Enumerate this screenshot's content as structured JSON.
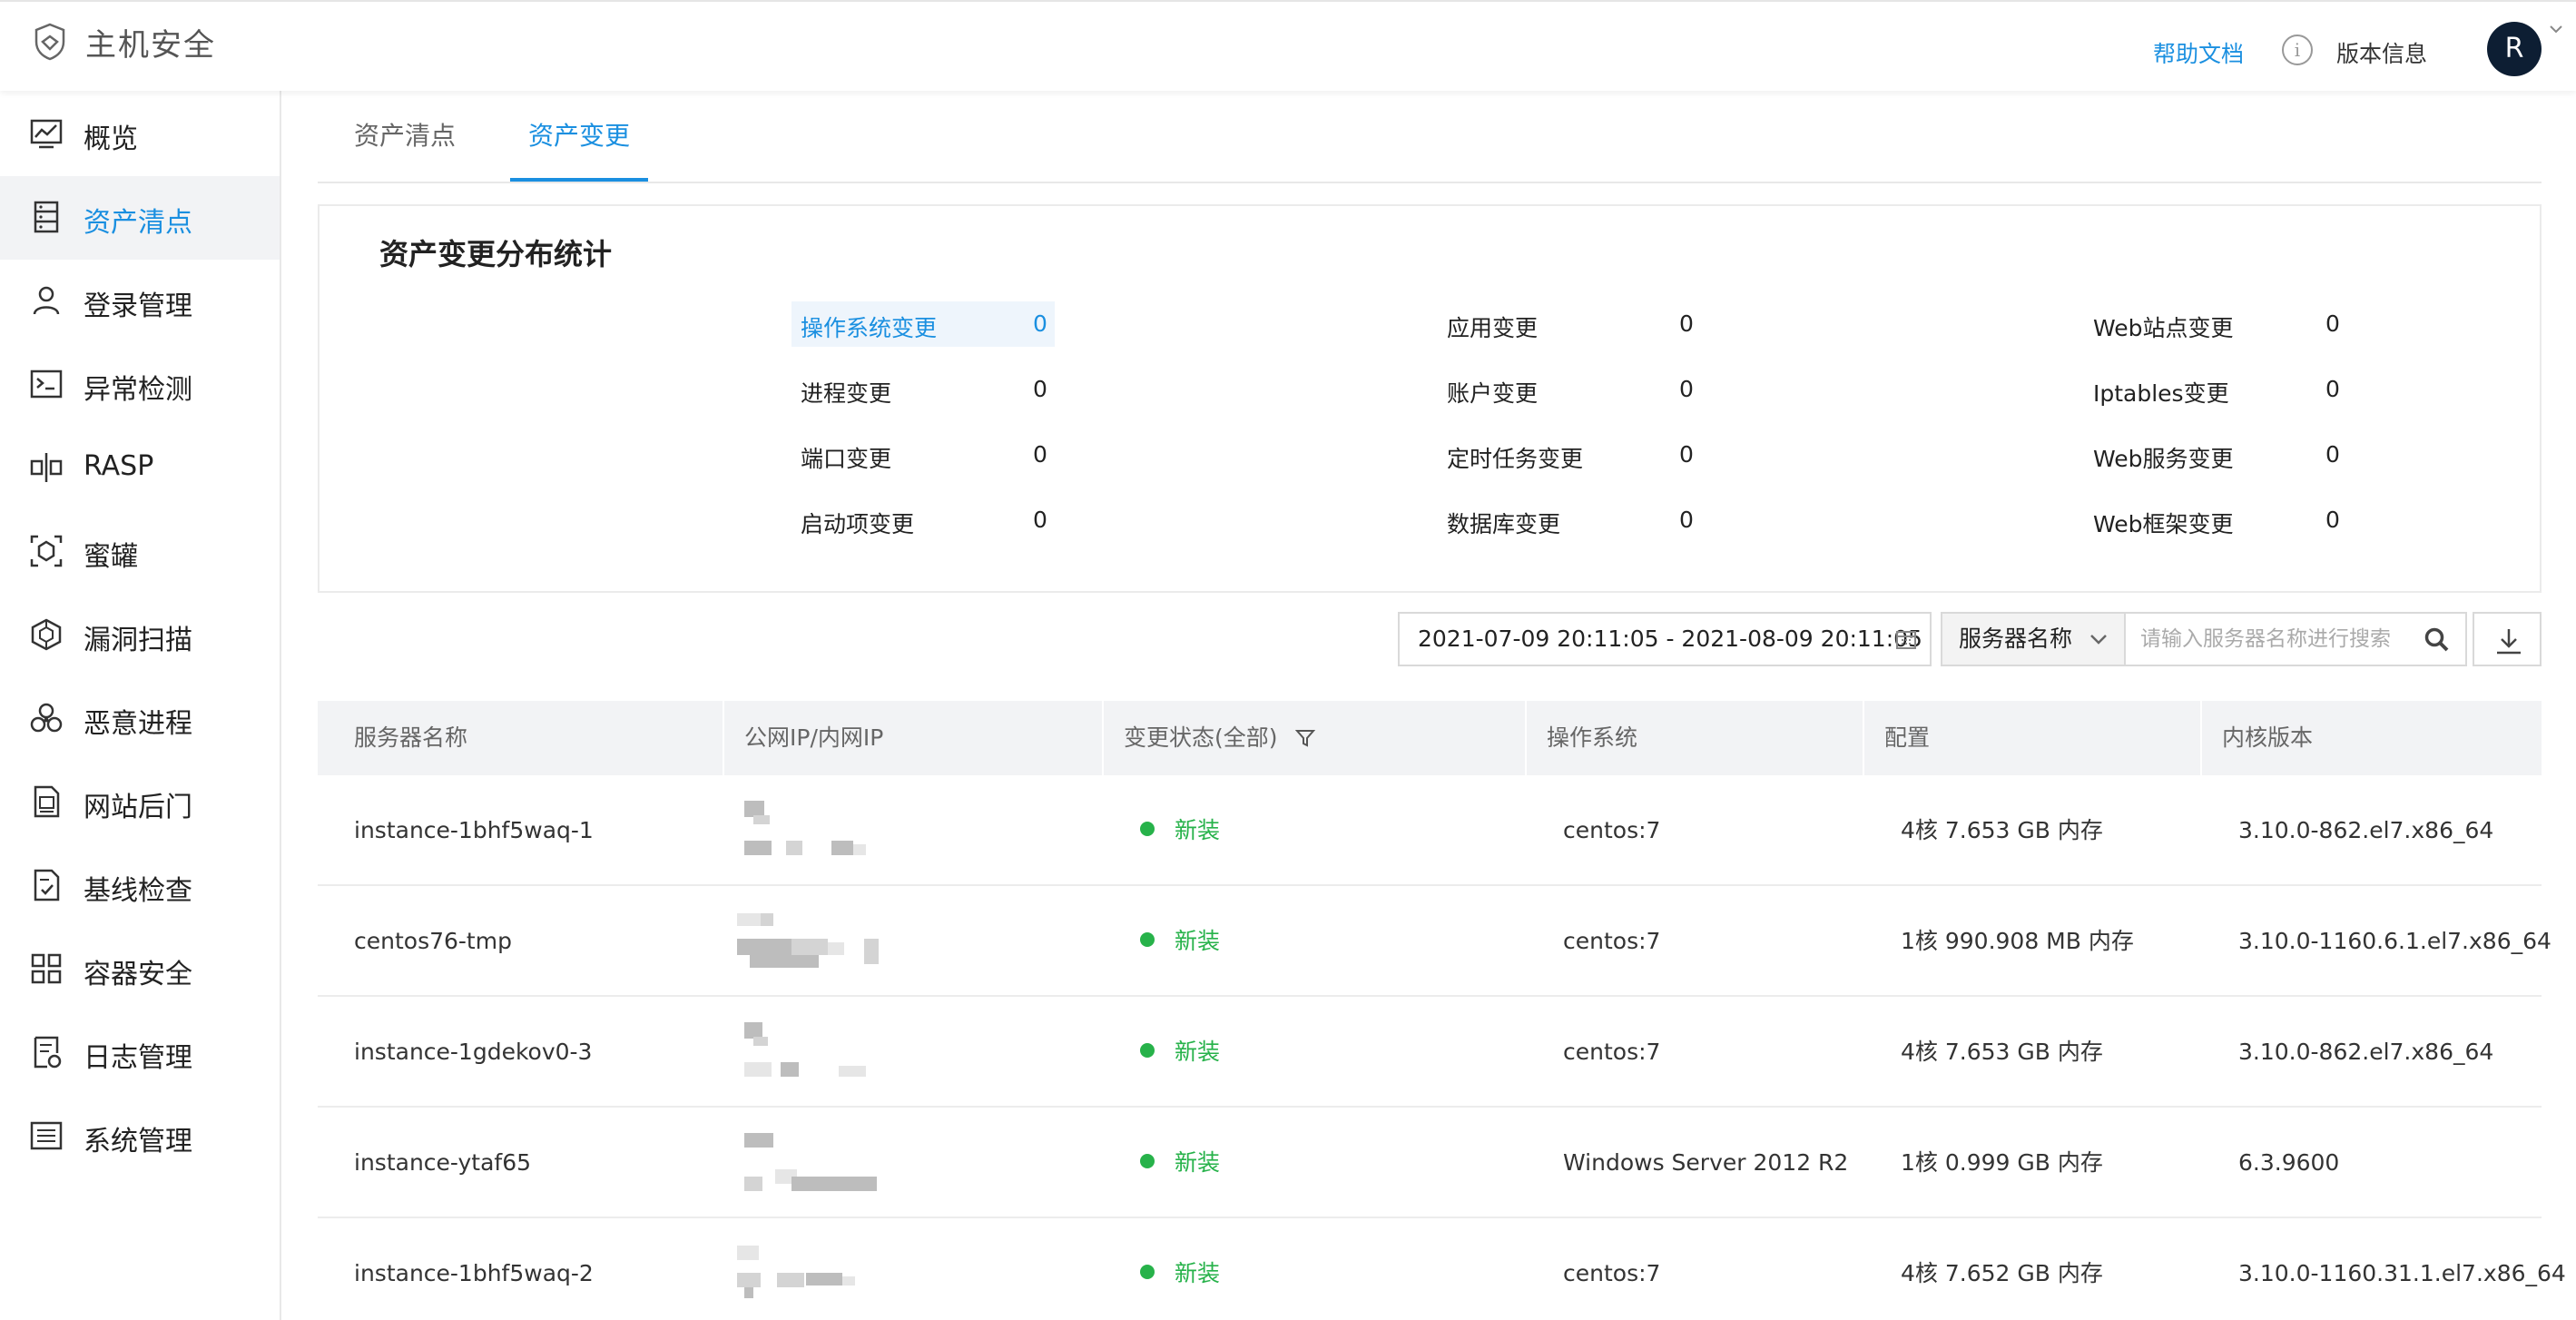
{
  "header": {
    "app_title": "主机安全",
    "help_label": "帮助文档",
    "version_label": "版本信息",
    "avatar_initial": "R"
  },
  "sidebar": {
    "items": [
      {
        "label": "概览",
        "icon": "monitor-icon"
      },
      {
        "label": "资产清点",
        "icon": "list-icon",
        "active": true
      },
      {
        "label": "登录管理",
        "icon": "user-icon"
      },
      {
        "label": "异常检测",
        "icon": "terminal-icon"
      },
      {
        "label": "RASP",
        "icon": "rasp-icon"
      },
      {
        "label": "蜜罐",
        "icon": "honeypot-icon"
      },
      {
        "label": "漏洞扫描",
        "icon": "cube-icon"
      },
      {
        "label": "恶意进程",
        "icon": "biohazard-icon"
      },
      {
        "label": "网站后门",
        "icon": "document-icon"
      },
      {
        "label": "基线检查",
        "icon": "checklist-icon"
      },
      {
        "label": "容器安全",
        "icon": "grid-icon"
      },
      {
        "label": "日志管理",
        "icon": "log-icon"
      },
      {
        "label": "系统管理",
        "icon": "settings-list-icon"
      }
    ]
  },
  "tabs": [
    {
      "label": "资产清点",
      "active": false
    },
    {
      "label": "资产变更",
      "active": true
    }
  ],
  "stats": {
    "title": "资产变更分布统计",
    "items": [
      {
        "label": "操作系统变更",
        "value": "0",
        "highlight": true
      },
      {
        "label": "进程变更",
        "value": "0"
      },
      {
        "label": "端口变更",
        "value": "0"
      },
      {
        "label": "启动项变更",
        "value": "0"
      },
      {
        "label": "应用变更",
        "value": "0"
      },
      {
        "label": "账户变更",
        "value": "0"
      },
      {
        "label": "定时任务变更",
        "value": "0"
      },
      {
        "label": "数据库变更",
        "value": "0"
      },
      {
        "label": "Web站点变更",
        "value": "0"
      },
      {
        "label": "Iptables变更",
        "value": "0"
      },
      {
        "label": "Web服务变更",
        "value": "0"
      },
      {
        "label": "Web框架变更",
        "value": "0"
      }
    ]
  },
  "filters": {
    "date_range": "2021-07-09 20:11:05 - 2021-08-09 20:11:05",
    "search_field": "服务器名称",
    "search_placeholder": "请输入服务器名称进行搜索",
    "search_value": ""
  },
  "table": {
    "columns": [
      "服务器名称",
      "公网IP/内网IP",
      "变更状态(全部)",
      "操作系统",
      "配置",
      "内核版本"
    ],
    "rows": [
      {
        "name": "instance-1bhf5waq-1",
        "status": "新装",
        "os": "centos:7",
        "config": "4核 7.653 GB 内存",
        "kernel": "3.10.0-862.el7.x86_64"
      },
      {
        "name": "centos76-tmp",
        "status": "新装",
        "os": "centos:7",
        "config": "1核 990.908 MB 内存",
        "kernel": "3.10.0-1160.6.1.el7.x86_64"
      },
      {
        "name": "instance-1gdekov0-3",
        "status": "新装",
        "os": "centos:7",
        "config": "4核 7.653 GB 内存",
        "kernel": "3.10.0-862.el7.x86_64"
      },
      {
        "name": "instance-ytaf65",
        "status": "新装",
        "os": "Windows Server 2012 R2",
        "config": "1核 0.999 GB 内存",
        "kernel": "6.3.9600"
      },
      {
        "name": "instance-1bhf5waq-2",
        "status": "新装",
        "os": "centos:7",
        "config": "4核 7.652 GB 内存",
        "kernel": "3.10.0-1160.31.1.el7.x86_64"
      }
    ]
  },
  "colors": {
    "accent": "#1a8fe0",
    "status_green": "#27b24a",
    "avatar_bg": "#0d1e33"
  }
}
